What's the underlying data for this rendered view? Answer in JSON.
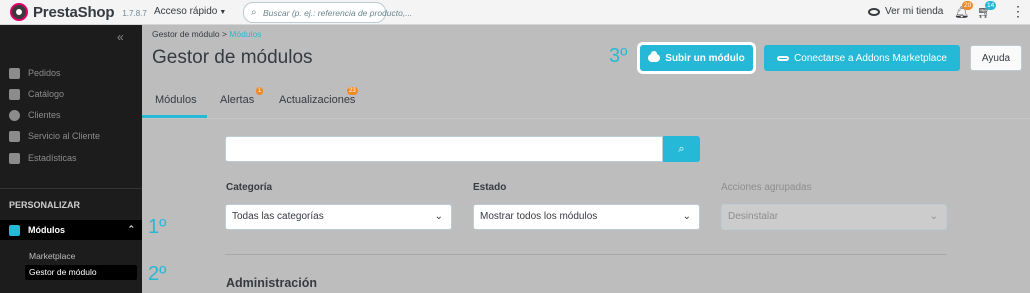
{
  "header": {
    "logo_text": "PrestaShop",
    "version": "1.7.8.7",
    "quick_access": "Acceso rápido",
    "search_placeholder": "Buscar (p. ej.: referencia de producto,...",
    "view_shop": "Ver mi tienda",
    "orders_badge": "20",
    "customers_badge": "14",
    "icons": [
      "search-icon",
      "eye-icon",
      "bell-icon",
      "cart-icon",
      "kebab-menu-icon"
    ]
  },
  "sidebar": {
    "collapse": "«",
    "items": [
      {
        "label": "Pedidos",
        "icon": "cart-icon"
      },
      {
        "label": "Catálogo",
        "icon": "store-icon"
      },
      {
        "label": "Clientes",
        "icon": "user-icon"
      },
      {
        "label": "Servicio al Cliente",
        "icon": "chat-icon"
      },
      {
        "label": "Estadísticas",
        "icon": "chart-icon"
      }
    ],
    "section": "PERSONALIZAR",
    "active": {
      "label": "Módulos",
      "icon": "puzzle-icon"
    },
    "subitems": [
      "Marketplace",
      "Gestor de módulo"
    ]
  },
  "breadcrumb": {
    "parent": "Gestor de módulo",
    "sep": ">",
    "current": "Módulos"
  },
  "page": {
    "title": "Gestor de módulos"
  },
  "toolbar": {
    "upload_label": "Subir un módulo",
    "addons_label": "Conectarse a Addons Marketplace",
    "help_label": "Ayuda"
  },
  "steps": {
    "one": "1º",
    "two": "2º",
    "three": "3º"
  },
  "tabs": [
    {
      "label": "Módulos"
    },
    {
      "label": "Alertas",
      "badge": "1"
    },
    {
      "label": "Actualizaciones",
      "badge": "23"
    }
  ],
  "filters": {
    "category_label": "Categoría",
    "category_value": "Todas las categorías",
    "status_label": "Estado",
    "status_value": "Mostrar todos los módulos",
    "bulk_label": "Acciones agrupadas",
    "bulk_value": "Desinstalar"
  },
  "section": {
    "title": "Administración"
  },
  "colors": {
    "accent": "#25b9d7",
    "sidebar": "#1c1c1c",
    "badge": "#ef8b26",
    "brand": "#df0067"
  }
}
